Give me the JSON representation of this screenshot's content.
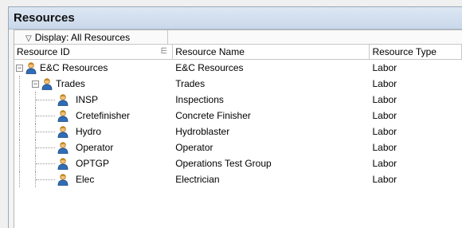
{
  "panel": {
    "title": "Resources"
  },
  "filter": {
    "label": "Display: All Resources"
  },
  "columns": {
    "resource_id": "Resource ID",
    "resource_name": "Resource Name",
    "resource_type": "Resource Type"
  },
  "rows": [
    {
      "id": "E&C Resources",
      "name": "E&C Resources",
      "type": "Labor",
      "level": 0,
      "toggle": "−"
    },
    {
      "id": "Trades",
      "name": "Trades",
      "type": "Labor",
      "level": 1,
      "toggle": "−"
    },
    {
      "id": "INSP",
      "name": "Inspections",
      "type": "Labor",
      "level": 2
    },
    {
      "id": "Cretefinisher",
      "name": "Concrete Finisher",
      "type": "Labor",
      "level": 2
    },
    {
      "id": "Hydro",
      "name": "Hydroblaster",
      "type": "Labor",
      "level": 2
    },
    {
      "id": "Operator",
      "name": "Operator",
      "type": "Labor",
      "level": 2
    },
    {
      "id": "OPTGP",
      "name": "Operations Test Group",
      "type": "Labor",
      "level": 2
    },
    {
      "id": "Elec",
      "name": "Electrician",
      "type": "Labor",
      "level": 2
    }
  ]
}
